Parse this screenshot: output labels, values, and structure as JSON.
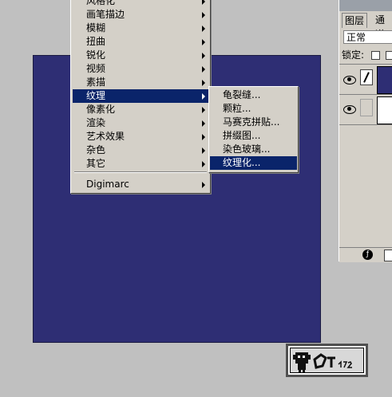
{
  "filter_menu": {
    "items": [
      {
        "label": "风格化",
        "has_submenu": true
      },
      {
        "label": "画笔描边",
        "has_submenu": true
      },
      {
        "label": "模糊",
        "has_submenu": true
      },
      {
        "label": "扭曲",
        "has_submenu": true
      },
      {
        "label": "锐化",
        "has_submenu": true
      },
      {
        "label": "视频",
        "has_submenu": true
      },
      {
        "label": "素描",
        "has_submenu": true
      },
      {
        "label": "纹理",
        "has_submenu": true,
        "active": true
      },
      {
        "label": "像素化",
        "has_submenu": true
      },
      {
        "label": "渲染",
        "has_submenu": true
      },
      {
        "label": "艺术效果",
        "has_submenu": true
      },
      {
        "label": "杂色",
        "has_submenu": true
      },
      {
        "label": "其它",
        "has_submenu": true
      }
    ],
    "extra": {
      "label": "Digimarc",
      "has_submenu": true
    }
  },
  "texture_submenu": {
    "items": [
      {
        "label": "龟裂缝..."
      },
      {
        "label": "颗粒..."
      },
      {
        "label": "马赛克拼贴..."
      },
      {
        "label": "拼缀图..."
      },
      {
        "label": "染色玻璃..."
      },
      {
        "label": "纹理化...",
        "active": true
      }
    ]
  },
  "layers_panel": {
    "tab_layers": "图层",
    "tab_channels": "通道",
    "blend_mode": "正常",
    "lock_label": "锁定:"
  },
  "colors": {
    "canvas": "#2e2e74",
    "highlight": "#0a246a",
    "menu_bg": "#d4d0c8",
    "workspace": "#c0c0c0"
  }
}
